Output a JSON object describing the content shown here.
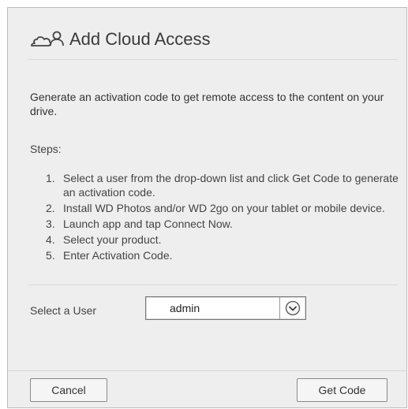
{
  "dialog": {
    "title": "Add Cloud Access",
    "title_icon": "cloud-user-icon",
    "description": "Generate an activation code to get remote access to the content on your drive.",
    "steps_label": "Steps:",
    "steps": [
      {
        "num": "1.",
        "text": "Select a user from the drop-down list and click Get Code to generate an activation code."
      },
      {
        "num": "2.",
        "text": "Install WD Photos and/or WD 2go on your tablet or mobile device."
      },
      {
        "num": "3.",
        "text": "Launch app and tap Connect Now."
      },
      {
        "num": "4.",
        "text": "Select your product."
      },
      {
        "num": "5.",
        "text": "Enter Activation Code."
      }
    ],
    "user_label": "Select a User",
    "user_select": {
      "value": "admin",
      "icon": "chevron-down-circle-icon"
    },
    "buttons": {
      "cancel": "Cancel",
      "get_code": "Get Code"
    }
  },
  "colors": {
    "dialog_bg": "#eeeeee",
    "border": "#bdbdbd",
    "text": "#333333"
  }
}
